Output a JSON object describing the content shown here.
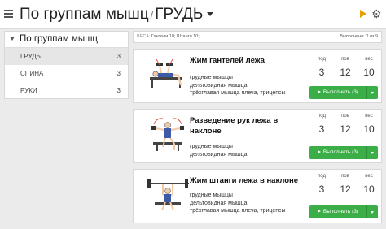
{
  "header": {
    "title_part1": "По группам мышц",
    "separator": "/",
    "title_part2": "ГРУДЬ"
  },
  "sidebar": {
    "heading": "По группам мышц",
    "items": [
      {
        "label": "ГРУДЬ",
        "count": "3",
        "active": true
      },
      {
        "label": "СПИНА",
        "count": "3",
        "active": false
      },
      {
        "label": "РУКИ",
        "count": "3",
        "active": false
      }
    ]
  },
  "infobar": {
    "weights_label": "ВЕСА:",
    "dumbbells": "Гантели 10;",
    "barbells": "Штанги 10;",
    "progress": "Выполнено: 0 из 9"
  },
  "stat_labels": {
    "sets": "под",
    "reps": "пов",
    "weight": "вес"
  },
  "exercises": [
    {
      "name": "Жим гантелей лежа",
      "muscles": [
        "грудные мышцы",
        "дельтовидная мышца",
        "трёхглавая мышца плеча, трицепсы"
      ],
      "sets": "3",
      "reps": "12",
      "weight": "10",
      "button": "Выполнить (3)"
    },
    {
      "name": "Разведение рук лежа в наклоне",
      "muscles": [
        "грудные мышцы",
        "дельтовидная мышца"
      ],
      "sets": "3",
      "reps": "12",
      "weight": "10",
      "button": "Выполнить (3)"
    },
    {
      "name": "Жим штанги лежа в наклоне",
      "muscles": [
        "грудные мышцы",
        "дельтовидная мышца",
        "трёхглавая мышца плеча, трицепсы"
      ],
      "sets": "3",
      "reps": "12",
      "weight": "10",
      "button": "Выполнить (3)"
    }
  ],
  "icons": {
    "menu": "hamburger-icon",
    "play": "play-icon",
    "settings": "gear-icon"
  },
  "colors": {
    "accent_green": "#3cae47",
    "play_orange": "#e8a000"
  }
}
